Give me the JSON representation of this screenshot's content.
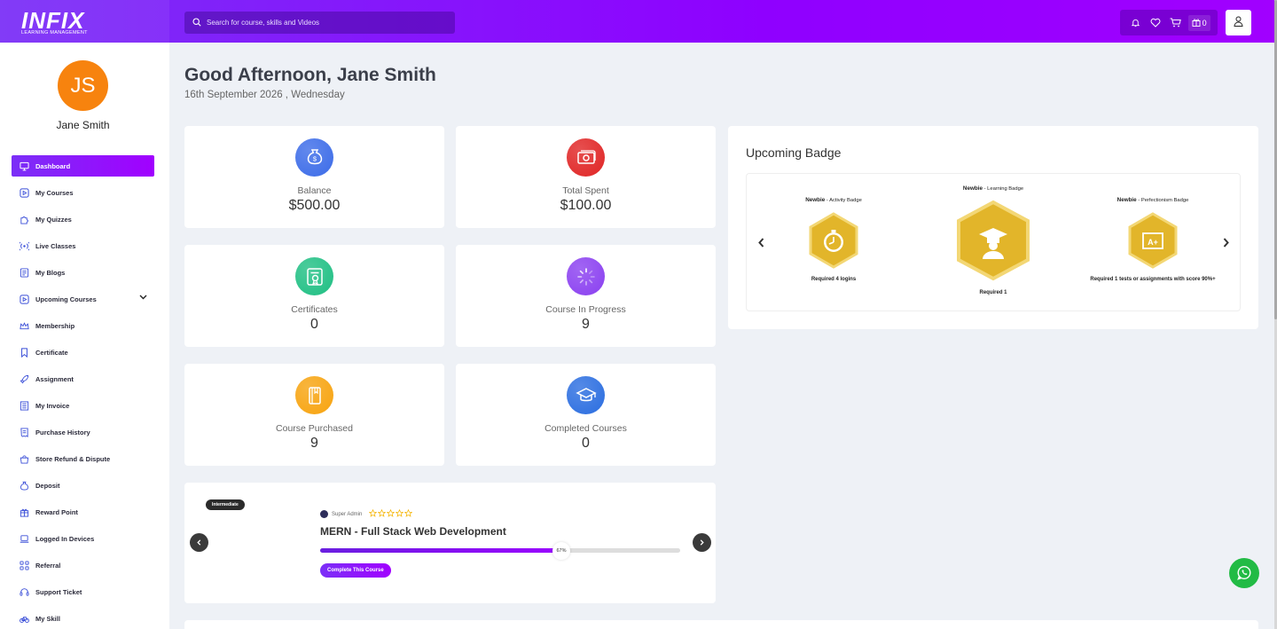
{
  "app": {
    "logo_text": "INFIX",
    "logo_subtitle": "LEARNING MANAGEMENT"
  },
  "search": {
    "placeholder": "Search for course, skills and Videos"
  },
  "header": {
    "gift_count": "0"
  },
  "sidebar": {
    "avatar_initials": "JS",
    "user_name": "Jane Smith",
    "items": [
      {
        "label": "Dashboard",
        "icon": "monitor-icon",
        "active": true
      },
      {
        "label": "My Courses",
        "icon": "play-square-icon"
      },
      {
        "label": "My Quizzes",
        "icon": "puzzle-icon"
      },
      {
        "label": "Live Classes",
        "icon": "broadcast-icon"
      },
      {
        "label": "My Blogs",
        "icon": "blog-icon"
      },
      {
        "label": "Upcoming Courses",
        "icon": "play-square-icon",
        "has_submenu": true
      },
      {
        "label": "Membership",
        "icon": "crown-icon"
      },
      {
        "label": "Certificate",
        "icon": "bookmark-icon"
      },
      {
        "label": "Assignment",
        "icon": "rocket-icon"
      },
      {
        "label": "My Invoice",
        "icon": "invoice-icon"
      },
      {
        "label": "Purchase History",
        "icon": "receipt-icon"
      },
      {
        "label": "Store Refund & Dispute",
        "icon": "bag-icon"
      },
      {
        "label": "Deposit",
        "icon": "money-bag-icon"
      },
      {
        "label": "Reward Point",
        "icon": "gift-icon"
      },
      {
        "label": "Logged In Devices",
        "icon": "laptop-icon"
      },
      {
        "label": "Referral",
        "icon": "network-icon"
      },
      {
        "label": "Support Ticket",
        "icon": "headset-icon"
      },
      {
        "label": "My Skill",
        "icon": "bicycle-icon"
      }
    ]
  },
  "main": {
    "greeting": "Good Afternoon, Jane Smith",
    "date": "16th September 2026 , Wednesday",
    "stats": [
      {
        "label": "Balance",
        "value": "$500.00",
        "icon": "money-bag-icon",
        "color": "#3b6be8"
      },
      {
        "label": "Total Spent",
        "value": "$100.00",
        "icon": "cash-icon",
        "color": "#e02424"
      },
      {
        "label": "Certificates",
        "value": "0",
        "icon": "certificate-icon",
        "color": "#1fbf83"
      },
      {
        "label": "Course In Progress",
        "value": "9",
        "icon": "spinner-icon",
        "color": "#8a3ff0"
      },
      {
        "label": "Course Purchased",
        "value": "9",
        "icon": "book-icon",
        "color": "#f7a30e"
      },
      {
        "label": "Completed Courses",
        "value": "0",
        "icon": "graduation-icon",
        "color": "#2a6de0"
      }
    ]
  },
  "badges": {
    "title": "Upcoming Badge",
    "items": [
      {
        "level": "Newbie",
        "sep": " - ",
        "type": "Activity Badge",
        "requirement": "Required 4 logins",
        "icon": "stopwatch-icon"
      },
      {
        "level": "Newbie",
        "sep": " - ",
        "type": "Learning Badge",
        "requirement": "Required 1",
        "icon": "student-icon"
      },
      {
        "level": "Newbie",
        "sep": " - ",
        "type": "Perfectionism Badge",
        "requirement": "Required 1 tests or assignments with score 90%+",
        "icon": "grade-icon"
      }
    ]
  },
  "course": {
    "level_tag": "Intermediate",
    "author": "Super Admin",
    "rating": 0,
    "title": "MERN - Full Stack Web Development",
    "progress": 67,
    "progress_label": "67%",
    "button_label": "Complete This Course"
  }
}
